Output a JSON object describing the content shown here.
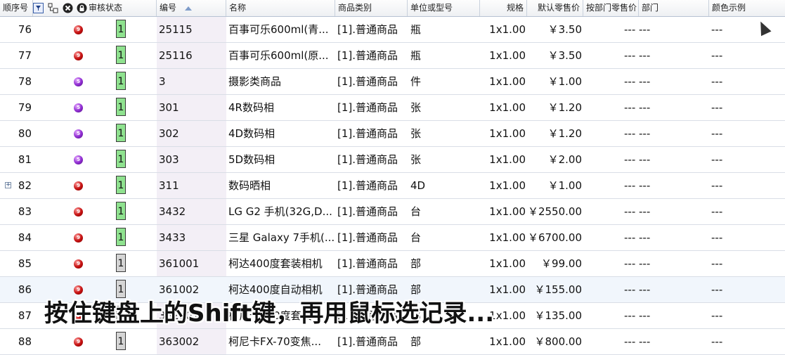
{
  "header": {
    "seq": "顺序号",
    "icons": [
      "filter-icon",
      "tree-icon",
      "close-icon",
      "lock-icon"
    ],
    "review": "审核状态",
    "code": "编号",
    "name": "名称",
    "category": "商品类别",
    "unit": "单位或型号",
    "spec": "规格",
    "price": "默认零售价",
    "deptPrice": "按部门零售价",
    "dept": "部门",
    "color": "颜色示例"
  },
  "rows": [
    {
      "seq": "76",
      "ball": "red",
      "ballNum": "9",
      "review": "1",
      "reviewColor": "g",
      "code": "25115",
      "name": "百事可乐600ml(青...",
      "category": "[1].普通商品",
      "unit": "瓶",
      "spec": "1x1.00",
      "price": "￥3.50",
      "deptPrice": "--- ---",
      "color": "---"
    },
    {
      "seq": "77",
      "ball": "red",
      "ballNum": "9",
      "review": "1",
      "reviewColor": "g",
      "code": "25116",
      "name": "百事可乐600ml(原...",
      "category": "[1].普通商品",
      "unit": "瓶",
      "spec": "1x1.00",
      "price": "￥3.50",
      "deptPrice": "--- ---",
      "color": "---"
    },
    {
      "seq": "78",
      "ball": "purple",
      "ballNum": "5",
      "review": "1",
      "reviewColor": "g",
      "code": "3",
      "name": "摄影类商品",
      "category": "[1].普通商品",
      "unit": "件",
      "spec": "1x1.00",
      "price": "￥1.00",
      "deptPrice": "--- ---",
      "color": "---"
    },
    {
      "seq": "79",
      "ball": "purple",
      "ballNum": "5",
      "review": "1",
      "reviewColor": "g",
      "code": "301",
      "name": "4R数码相",
      "category": "[1].普通商品",
      "unit": "张",
      "spec": "1x1.00",
      "price": "￥1.20",
      "deptPrice": "--- ---",
      "color": "---"
    },
    {
      "seq": "80",
      "ball": "purple",
      "ballNum": "5",
      "review": "1",
      "reviewColor": "g",
      "code": "302",
      "name": "4D数码相",
      "category": "[1].普通商品",
      "unit": "张",
      "spec": "1x1.00",
      "price": "￥1.20",
      "deptPrice": "--- ---",
      "color": "---"
    },
    {
      "seq": "81",
      "ball": "purple",
      "ballNum": "5",
      "review": "1",
      "reviewColor": "g",
      "code": "303",
      "name": "5D数码相",
      "category": "[1].普通商品",
      "unit": "张",
      "spec": "1x1.00",
      "price": "￥2.00",
      "deptPrice": "--- ---",
      "color": "---"
    },
    {
      "seq": "82",
      "ball": "red",
      "ballNum": "9",
      "review": "1",
      "reviewColor": "g",
      "code": "311",
      "name": "数码晒相",
      "category": "[1].普通商品",
      "unit": "4D",
      "spec": "1x1.00",
      "price": "￥1.00",
      "deptPrice": "--- ---",
      "color": "---",
      "expand": true
    },
    {
      "seq": "83",
      "ball": "red",
      "ballNum": "9",
      "review": "1",
      "reviewColor": "g",
      "code": "3432",
      "name": "LG G2 手机(32G,D...",
      "category": "[1].普通商品",
      "unit": "台",
      "spec": "1x1.00",
      "price": "￥2550.00",
      "deptPrice": "--- ---",
      "color": "---"
    },
    {
      "seq": "84",
      "ball": "red",
      "ballNum": "9",
      "review": "1",
      "reviewColor": "g",
      "code": "3433",
      "name": "三星 Galaxy 7手机(...",
      "category": "[1].普通商品",
      "unit": "台",
      "spec": "1x1.00",
      "price": "￥6700.00",
      "deptPrice": "--- ---",
      "color": "---"
    },
    {
      "seq": "85",
      "ball": "red",
      "ballNum": "9",
      "review": "1",
      "reviewColor": "y",
      "code": "361001",
      "name": "柯达400度套装相机",
      "category": "[1].普通商品",
      "unit": "部",
      "spec": "1x1.00",
      "price": "￥99.00",
      "deptPrice": "--- ---",
      "color": "---"
    },
    {
      "seq": "86",
      "ball": "red",
      "ballNum": "9",
      "review": "1",
      "reviewColor": "y",
      "code": "361002",
      "name": "柯达400度自动相机",
      "category": "[1].普通商品",
      "unit": "部",
      "spec": "1x1.00",
      "price": "￥155.00",
      "deptPrice": "--- ---",
      "color": "---",
      "selected": true
    },
    {
      "seq": "87",
      "ball": "red",
      "ballNum": "9",
      "review": "1",
      "reviewColor": "y",
      "code": "362001",
      "name": "柯尼卡400度套装",
      "category": "[1].普通商品",
      "unit": "部",
      "spec": "1x1.00",
      "price": "￥135.00",
      "deptPrice": "--- ---",
      "color": "---"
    },
    {
      "seq": "88",
      "ball": "red",
      "ballNum": "9",
      "review": "1",
      "reviewColor": "y",
      "code": "363002",
      "name": "柯尼卡FX-70变焦...",
      "category": "[1].普通商品",
      "unit": "部",
      "spec": "1x1.00",
      "price": "￥800.00",
      "deptPrice": "--- ---",
      "color": "---"
    }
  ],
  "overlay": "按住键盘上的Shift键，再用鼠标选记录..."
}
